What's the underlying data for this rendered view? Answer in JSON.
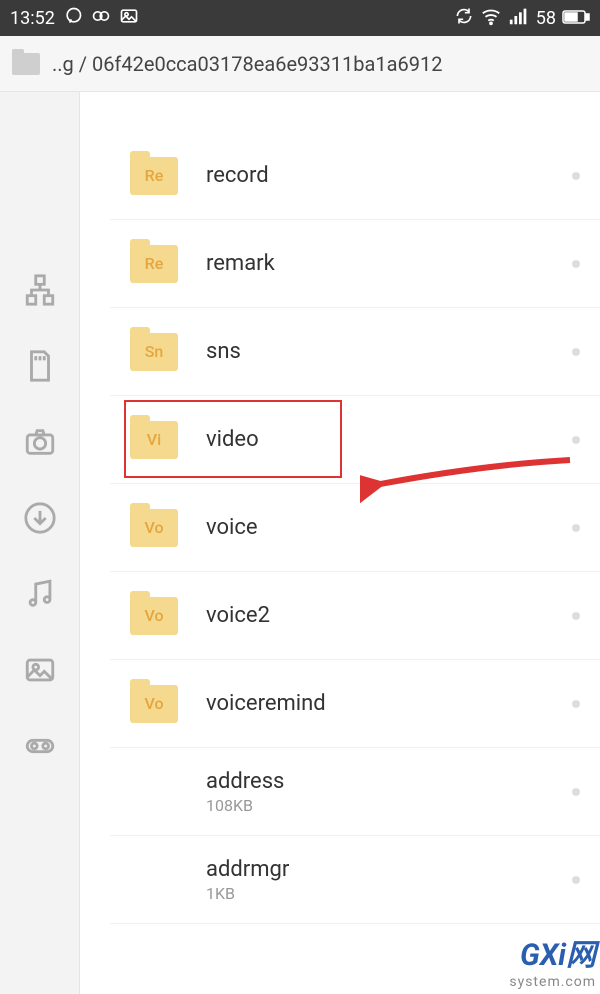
{
  "status": {
    "time": "13:52",
    "battery": "58"
  },
  "path": {
    "prefix": "..g / ",
    "folder": "06f42e0cca03178ea6e93311ba1a6912"
  },
  "sidebar": {
    "items": [
      {
        "name": "network-icon"
      },
      {
        "name": "sdcard-icon"
      },
      {
        "name": "camera-icon"
      },
      {
        "name": "download-icon"
      },
      {
        "name": "music-icon"
      },
      {
        "name": "picture-icon"
      },
      {
        "name": "misc-icon"
      }
    ]
  },
  "files": [
    {
      "icon": "Re",
      "name": "record",
      "type": "folder"
    },
    {
      "icon": "Re",
      "name": "remark",
      "type": "folder"
    },
    {
      "icon": "Sn",
      "name": "sns",
      "type": "folder"
    },
    {
      "icon": "Vi",
      "name": "video",
      "type": "folder",
      "highlighted": true
    },
    {
      "icon": "Vo",
      "name": "voice",
      "type": "folder"
    },
    {
      "icon": "Vo",
      "name": "voice2",
      "type": "folder"
    },
    {
      "icon": "Vo",
      "name": "voiceremind",
      "type": "folder"
    },
    {
      "icon": "",
      "name": "address",
      "type": "file",
      "meta": "108KB"
    },
    {
      "icon": "",
      "name": "addrmgr",
      "type": "file",
      "meta": "1KB"
    }
  ],
  "watermark": {
    "line1": "GXi网",
    "line2": "system.com"
  }
}
